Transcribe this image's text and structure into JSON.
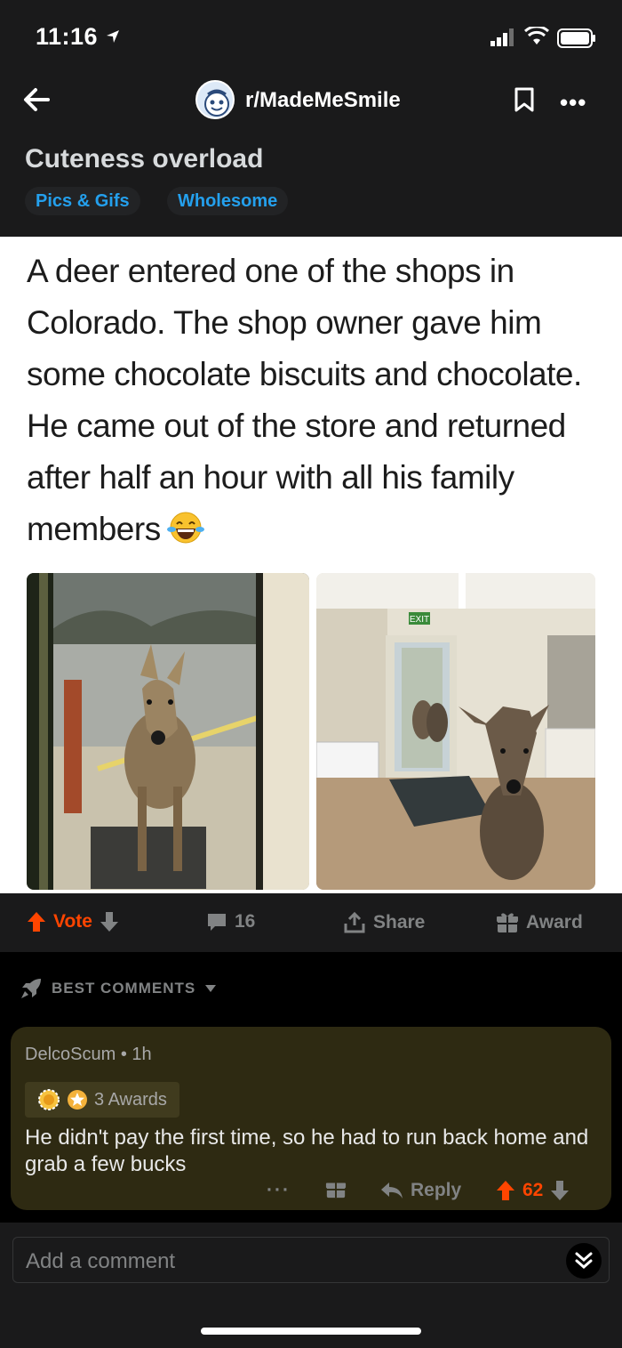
{
  "status_bar": {
    "time": "11:16"
  },
  "nav": {
    "subreddit": "r/MadeMeSmile"
  },
  "post": {
    "title": "Cuteness overload",
    "flairs": [
      "Pics & Gifs",
      "Wholesome"
    ],
    "caption": "A deer entered one of the shops in Colorado. The shop owner gave him some chocolate biscuits and chocolate. He came out of the store and returned after half an hour with all his family members",
    "sign_text": "EXIT"
  },
  "actions": {
    "vote": "Vote",
    "comments": "16",
    "share": "Share",
    "award": "Award"
  },
  "comments_header": {
    "sort_label": "BEST COMMENTS"
  },
  "comment": {
    "author": "DelcoScum",
    "separator": "•",
    "age": "1h",
    "awards": "3 Awards",
    "body": "He didn't pay the first time, so he had to run back home and grab a few bucks",
    "more": "···",
    "reply": "Reply",
    "score": "62"
  },
  "composer": {
    "placeholder": "Add a comment"
  },
  "colors": {
    "background": "#1a1a1b",
    "accent_upvote": "#ff4500",
    "flair_text": "#24a0ed",
    "comment_highlight": "#2e2a12"
  },
  "icons": [
    "location-arrow-icon",
    "signal-icon",
    "wifi-icon",
    "battery-icon",
    "back-arrow-icon",
    "bookmark-icon",
    "more-icon",
    "upvote-icon",
    "downvote-icon",
    "comment-icon",
    "share-icon",
    "gift-icon",
    "rocket-icon",
    "chevron-down-icon",
    "double-chevron-down-icon"
  ]
}
